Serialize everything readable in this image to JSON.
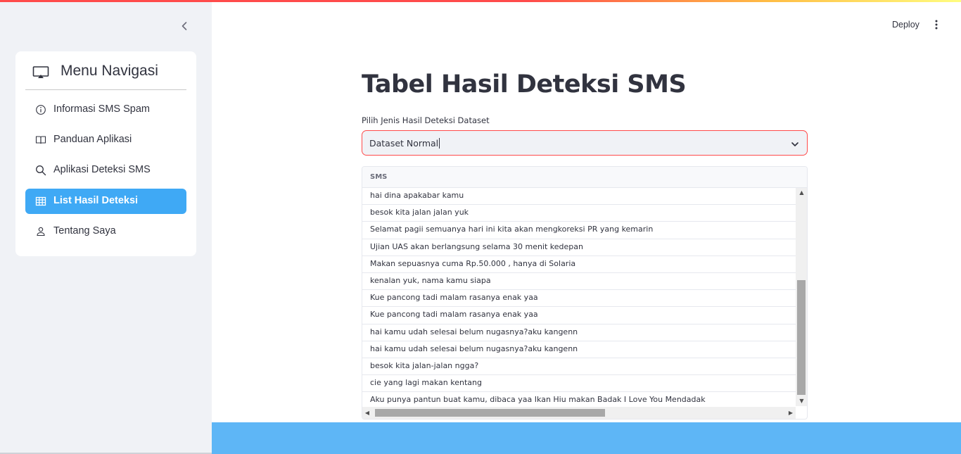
{
  "header": {
    "deploy_label": "Deploy"
  },
  "sidebar": {
    "menu_title": "Menu Navigasi",
    "items": [
      {
        "label": "Informasi SMS Spam",
        "icon": "info-circle-icon",
        "active": false
      },
      {
        "label": "Panduan Aplikasi",
        "icon": "book-icon",
        "active": false
      },
      {
        "label": "Aplikasi Deteksi SMS",
        "icon": "search-icon",
        "active": false
      },
      {
        "label": "List Hasil Deteksi",
        "icon": "table-icon",
        "active": true
      },
      {
        "label": "Tentang Saya",
        "icon": "person-icon",
        "active": false
      }
    ]
  },
  "main": {
    "title": "Tabel Hasil Deteksi SMS",
    "select": {
      "label": "Pilih Jenis Hasil Deteksi Dataset",
      "value": "Dataset Normal"
    },
    "table": {
      "column": "SMS",
      "rows": [
        "hai dina apakabar kamu",
        "besok kita jalan jalan yuk",
        "Selamat pagii semuanya hari ini kita akan mengkoreksi PR yang kemarin",
        "Ujian UAS akan berlangsung selama 30 menit kedepan",
        "Makan sepuasnya cuma Rp.50.000 , hanya di Solaria",
        "kenalan yuk, nama kamu siapa",
        "Kue pancong tadi malam rasanya enak yaa",
        "Kue pancong tadi malam rasanya enak yaa",
        "hai kamu udah selesai belum nugasnya?aku kangenn",
        "hai kamu udah selesai belum nugasnya?aku kangenn",
        "besok kita jalan-jalan ngga?",
        "cie yang lagi makan kentang",
        "Aku punya pantun buat kamu, dibaca yaa Ikan Hiu makan Badak I Love You Mendadak"
      ]
    }
  },
  "colors": {
    "accent": "#ff4b4b",
    "active_nav": "#3fa9f5",
    "sidebar_bg": "#f0f2f6",
    "footer_band": "#5eb6f6"
  }
}
